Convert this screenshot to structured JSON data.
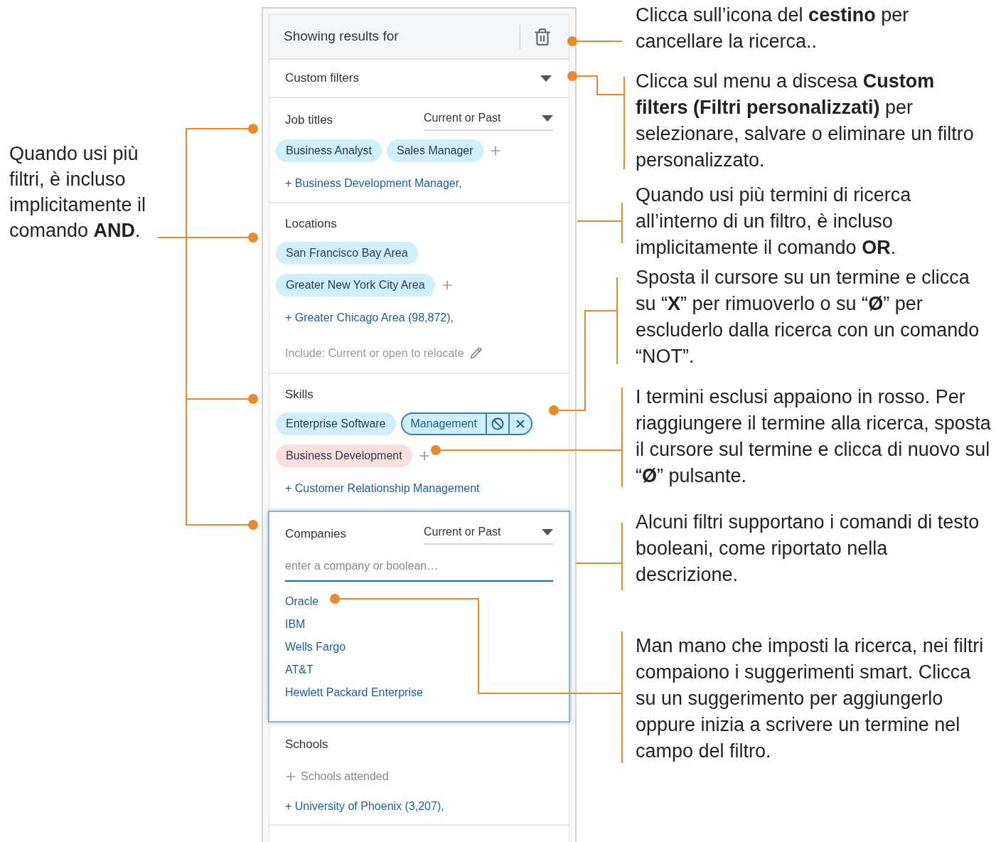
{
  "header": {
    "title": "Showing results for"
  },
  "custom_filters": {
    "label": "Custom filters"
  },
  "sections": [
    {
      "title": "Job titles",
      "dropdown": "Current or Past",
      "chips": [
        {
          "label": "Business Analyst",
          "excluded": false,
          "hovered": false
        },
        {
          "label": "Sales Manager",
          "excluded": false,
          "hovered": false
        }
      ],
      "suggestions": [
        "+ Business Development Manager,"
      ]
    },
    {
      "title": "Locations",
      "chips": [
        {
          "label": "San Francisco Bay Area",
          "excluded": false,
          "hovered": false
        },
        {
          "label": "Greater New York City Area",
          "excluded": false,
          "hovered": false
        }
      ],
      "suggestions": [
        "+ Greater Chicago Area (98,872),"
      ],
      "note": "Include: Current or open to relocate"
    },
    {
      "title": "Skills",
      "chips": [
        {
          "label": "Enterprise Software",
          "excluded": false,
          "hovered": false
        },
        {
          "label": "Management",
          "excluded": false,
          "hovered": true
        },
        {
          "label": "Business Development",
          "excluded": true,
          "hovered": false
        }
      ],
      "suggestions": [
        "+ Customer Relationship Management"
      ]
    },
    {
      "title": "Companies",
      "dropdown": "Current or Past",
      "focused": true,
      "input": {
        "placeholder": "enter a company or boolean…"
      },
      "suggestion_list": [
        "Oracle",
        "IBM",
        "Wells Fargo",
        "AT&T",
        "Hewlett Packard Enterprise"
      ]
    },
    {
      "title": "Schools",
      "add_prompt": "Schools attended",
      "suggestions": [
        "+ University of Phoenix (3,207),"
      ]
    }
  ],
  "annotations": {
    "left": "Quando usi più filtri, è incluso implicitamente il comando **AND**.",
    "right": [
      "Clicca sull’icona del **cestino** per cancellare la ricerca..",
      "Clicca sul menu a discesa **Custom filters (Filtri personalizzati)** per selezionare, salvare o eliminare un filtro personalizzato.",
      "Quando usi più termini di ricerca all’interno di un filtro, è incluso implicitamente il comando **OR**.",
      "Sposta il cursore su un termine e clicca su “**X**” per rimuoverlo o su “**Ø**” per escluderlo dalla ricerca con un comando “NOT”.",
      "I termini esclusi appaiono in rosso. Per riaggiungere il termine alla ricerca, sposta il cursore sul termine e clicca di nuovo sul “**Ø**” pulsante.",
      "Alcuni filtri supportano i comandi di testo booleani, come riportato nella descrizione.",
      "Man mano che imposti la ricerca, nei filtri compaiono i suggerimenti smart. Clicca su un suggerimento per aggiungerlo oppure inizia a scrivere un termine nel campo del filtro."
    ]
  }
}
